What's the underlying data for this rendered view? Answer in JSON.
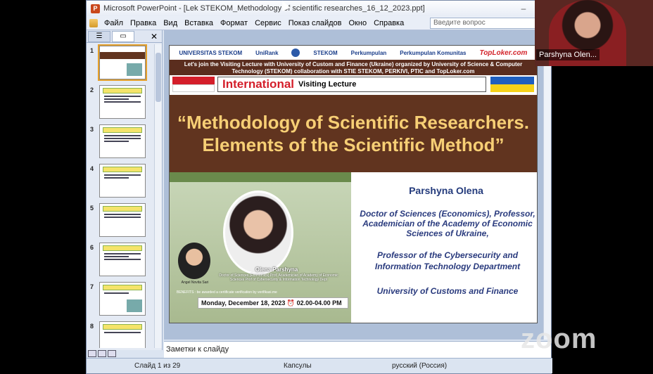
{
  "window": {
    "title": "Microsoft PowerPoint - [Lek STEKOM_Methodology of scientific researches_16_12_2023.ppt]"
  },
  "menu": {
    "items": [
      "Файл",
      "Правка",
      "Вид",
      "Вставка",
      "Формат",
      "Сервис",
      "Показ слайдов",
      "Окно",
      "Справка"
    ],
    "ask_placeholder": "Введите вопрос"
  },
  "thumbnails": [
    "1",
    "2",
    "3",
    "4",
    "5",
    "6",
    "7",
    "8"
  ],
  "slide": {
    "banner": "Let's join the Visiting Lecture with University of Custom and Finance (Ukraine) organized by University of Science & Computer Technology (STEKOM) collaboration with STIE STEKOM, PERKIVI, PTIC and TopLoker.com",
    "international": "International",
    "visiting": "Visiting Lecture",
    "headline1": "“Methodology of Scientific Researchers.",
    "headline2": "Elements of the Scientific Method”",
    "name": "Parshyna Olena",
    "desc": "Doctor of Sciences (Economics), Professor, Academician of the Academy of Economic Sciences of Ukraine,",
    "prof": "Professor of the Cybersecurity and Information Technology Department",
    "univ": "University of Customs and Finance",
    "photo_name": "Olena Parshyna",
    "photo_sub": "Doctor of Sciences (Economics) Prof. Academician of Academy of Economic Sciences Prof of Cybersecurity & Information Technology Dept",
    "benefits": "BENEFITS : be awarded a certificate verification by verifikasi.me",
    "date": "Monday, December 18, 2023 ⏰ 02.00-04.00 PM",
    "logos": [
      "UNIVERSITAS STEKOM",
      "UniRank",
      "STEKOM",
      "Perkumpulan",
      "Perkumpulan Komunitas",
      "TopLoker.com"
    ]
  },
  "notes_placeholder": "Заметки к слайду",
  "status": {
    "slide": "Слайд 1 из 29",
    "design": "Капсулы",
    "language": "русский (Россия)"
  },
  "participant": {
    "name": "Parshyna Olen..."
  },
  "zoom_logo": "zoom"
}
